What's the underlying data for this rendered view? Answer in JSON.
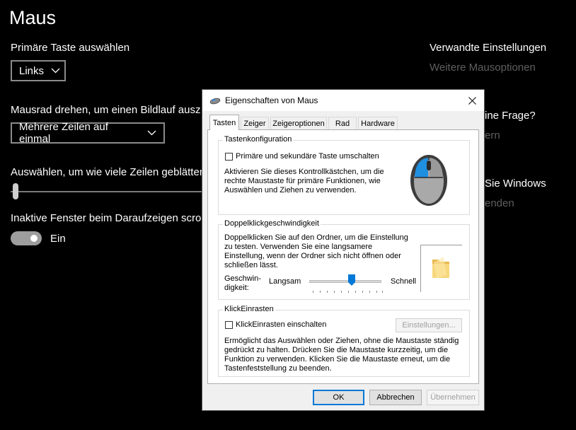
{
  "settings": {
    "title": "Maus",
    "primary_button": {
      "label": "Primäre Taste auswählen",
      "value": "Links"
    },
    "scroll_mode": {
      "label": "Mausrad drehen, um einen Bildlauf ausz",
      "value": "Mehrere Zeilen auf einmal"
    },
    "lines": {
      "label": "Auswählen, um wie viele Zeilen geblätter",
      "value": 1
    },
    "inactive_scroll": {
      "label": "Inaktive Fenster beim Daraufzeigen scroll",
      "state": "Ein"
    },
    "related": {
      "title": "Verwandte Einstellungen",
      "link": "Weitere Mausoptionen",
      "frag_question": "ine Frage?",
      "frag_link1": "ern",
      "frag_windows": "Sie Windows",
      "frag_link2": "enden"
    }
  },
  "dialog": {
    "title": "Eigenschaften von Maus",
    "tabs": [
      "Tasten",
      "Zeiger",
      "Zeigeroptionen",
      "Rad",
      "Hardware"
    ],
    "active_tab": "Tasten",
    "button_config": {
      "group_label": "Tastenkonfiguration",
      "checkbox_label": "Primäre und sekundäre Taste umschalten",
      "description": [
        "Aktivieren Sie dieses Kontrollkästchen, um die",
        "rechte Maustaste für primäre Funktionen, wie",
        "Auswählen und Ziehen zu verwenden."
      ]
    },
    "double_click": {
      "group_label": "Doppelklickgeschwindigkeit",
      "description": [
        "Doppelklicken Sie auf den Ordner, um die Einstellung",
        "zu testen. Verwenden Sie eine langsamere",
        "Einstellung, wenn der Ordner sich nicht öffnen oder",
        "schließen lässt."
      ],
      "speed_label": [
        "Geschwin-",
        "digkeit:"
      ],
      "slow": "Langsam",
      "fast": "Schnell",
      "speed_value": 0.6
    },
    "click_lock": {
      "group_label": "KlickEinrasten",
      "checkbox_label": "KlickEinrasten einschalten",
      "settings_button": "Einstellungen...",
      "description": [
        "Ermöglicht das Auswählen oder Ziehen, ohne die Maustaste ständig",
        "gedrückt zu halten. Drücken Sie die Maustaste kurzzeitig, um die",
        "Funktion zu verwenden. Klicken Sie die Maustaste erneut, um die",
        "Tastenfeststellung zu beenden."
      ]
    },
    "buttons": {
      "ok": "OK",
      "cancel": "Abbrechen",
      "apply": "Übernehmen"
    }
  },
  "colors": {
    "background": "#000000",
    "accent": "#0078d7",
    "muted_link": "#5f5f5f"
  }
}
